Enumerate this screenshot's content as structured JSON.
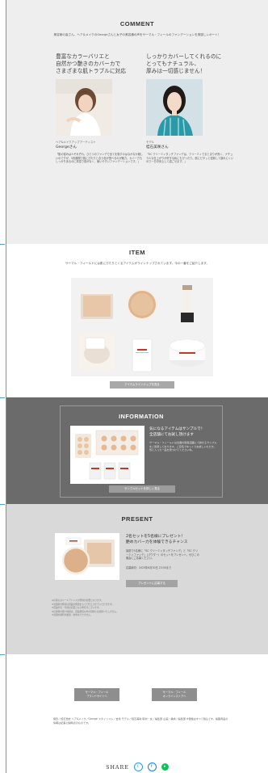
{
  "comment": {
    "title": "COMMENT",
    "subtitle": "美容家の皆さん、ヘア＆メイクのGeorgeさんと女子の美容通の声をサーマル・フィールのファンデーションを実感しレポート！",
    "left": {
      "headline": "豊富なカラーバリエと\n自然かつ艶きのカバーカで\nさまざまな肌トラブルに対応",
      "role": "ヘア&メイクアップアーティスト",
      "name": "Georgeさん",
      "text": "「肌の悩みは人それぞれ。ひとつのファンデで全てを隠すのはなかなか難しいのですが、5色展開で肌にぴたりと合う色が選べるのが魅力。カバー力もしっかりあるのに厚塗り感がなく、使いやすいファンデーションです。」"
    },
    "right": {
      "headline": "しっかりカバーしてくれるのに\nとってもナチュラル、\n厚みは一切感じません！",
      "role": "モデル",
      "name": "桂石美咲さん",
      "text": "「SC クリーミィタッチファンデは、クリーミィでまとまりが良く、ナチュラルな仕上がりが好きな私にもぴったり。肌にピタッと密着して崩れにくいので一日中安心して過ごせます。」"
    }
  },
  "item": {
    "title": "ITEM",
    "subtitle": "サーマル・フィールドには肌にぴたりとくるアイテムがラインナップされています。今の一番をご紹介します。",
    "button": "アイテムラインナップを見る"
  },
  "information": {
    "title": "INFORMATION",
    "headline": "気になるアイテムはサンプルで！\n全店舗にてお試し頂けます",
    "body": "サーマル・フィールドは全国の取扱店舗にて試せるサンプルをご用意しております。ご自宅でゆっくりお試しいただき、気に入った一品を見つけてくださいね。",
    "button": "サンプルセットを詳しく見る"
  },
  "present": {
    "title": "PRESENT",
    "headline": "2名セットを5名様にプレゼント！\n艶めカバー力を体験できるチャンス",
    "body": "抽選で5名様に「SC クリーミィタッチファンデ」と「SC クリーミィファンデ」（パウダー）のセットをプレゼント。ぜひこの機会にご応募ください。",
    "deadline": "応募締切：2025年6月30日 23:59まで",
    "button": "プレゼントに応募する",
    "notes": [
      "※応募にはメールアドレスの登録が必要となります。",
      "※当選者の発表は賞品の発送をもって代えさせていただきます。",
      "※賞品の色・仕様は変更となる場合がございます。",
      "※応募者の個人情報は、賞品発送以外の目的には使用いたしません。",
      "※当選の権利の譲渡、換金はできません。"
    ]
  },
  "footer": {
    "buttons": [
      "サーマル・フィール\nブランドサイトへ",
      "サーマル・フィール\nオンラインストアへ"
    ],
    "credits": "撮影／桂石浩史 ヘア&メイク／George スタイリスト／吉永 モデル／桂石美咲 取材・文／編集部 企画・構成／編集部 ※価格はすべて税込です。掲載商品の情報は記事公開時点のものです。",
    "share_label": "SHARE"
  },
  "colors": {
    "comment_bg": "#eeeeee",
    "info_bg": "#6b6b6b",
    "present_bg": "#d9d9d9",
    "twitter": "#1da1f2",
    "facebook": "#1877f2",
    "line": "#06c755"
  },
  "icons": [
    "twitter-icon",
    "facebook-icon",
    "line-icon"
  ]
}
